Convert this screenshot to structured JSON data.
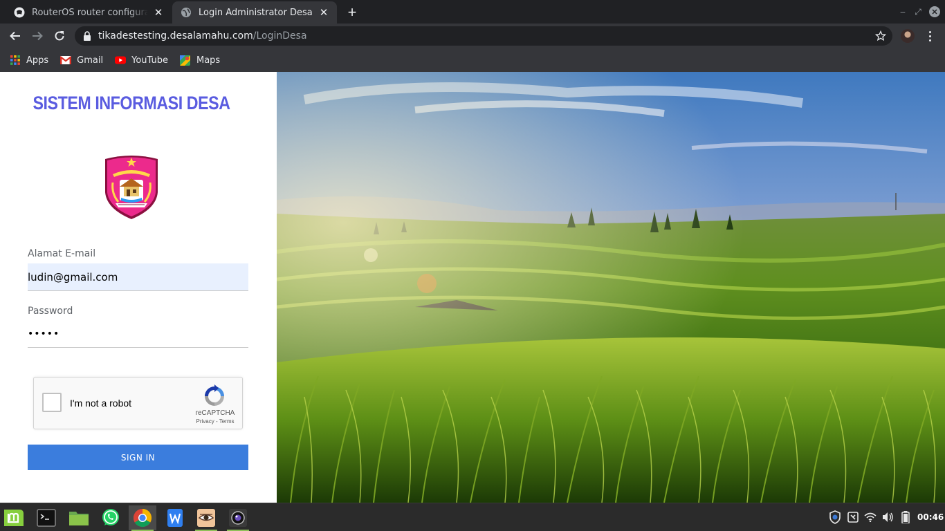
{
  "browser": {
    "tabs": [
      {
        "title": "RouterOS router configuration page",
        "favicon": "routeros-icon",
        "active": false
      },
      {
        "title": "Login Administrator Desa",
        "favicon": "globe-icon",
        "active": true
      }
    ],
    "url_host": "tikadestesting.desalamahu.com",
    "url_path": "/LoginDesa",
    "bookmarks": [
      {
        "label": "Apps",
        "icon": "apps-grid-icon"
      },
      {
        "label": "Gmail",
        "icon": "gmail-icon"
      },
      {
        "label": "YouTube",
        "icon": "youtube-icon"
      },
      {
        "label": "Maps",
        "icon": "maps-icon"
      }
    ]
  },
  "login": {
    "title": "SISTEM INFORMASI DESA",
    "email_label": "Alamat E-mail",
    "email_value": "ludin@gmail.com",
    "password_label": "Password",
    "password_value": "•••••",
    "captcha_text": "I'm not a robot",
    "captcha_brand": "reCAPTCHA",
    "captcha_links": "Privacy - Terms",
    "signin_label": "SIGN IN"
  },
  "colors": {
    "title": "#5a5ce0",
    "signin": "#3b7ddd",
    "autofill": "#e8f0fe"
  },
  "taskbar": {
    "apps": [
      "mint-menu-icon",
      "terminal-icon",
      "files-icon",
      "whatsapp-icon",
      "chrome-icon",
      "wps-writer-icon",
      "eye-app-icon",
      "camera-app-icon"
    ],
    "clock": "00:46"
  }
}
